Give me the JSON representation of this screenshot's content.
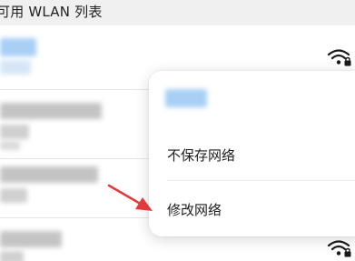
{
  "section": {
    "title": "可用 WLAN 列表"
  },
  "networks": [
    {
      "name": "",
      "icon": "wifi-locked-icon"
    },
    {
      "name": "",
      "icon": "wifi-icon"
    },
    {
      "name": "",
      "icon": "wifi-icon"
    },
    {
      "name": "",
      "icon": "wifi-locked-icon"
    }
  ],
  "context_menu": {
    "network_name": "",
    "items": [
      {
        "label": "不保存网络"
      },
      {
        "label": "修改网络"
      }
    ]
  },
  "colors": {
    "arrow": "#e23b3b",
    "blur_blue": "#a9cff5",
    "blur_gray": "#c4c4c4"
  }
}
